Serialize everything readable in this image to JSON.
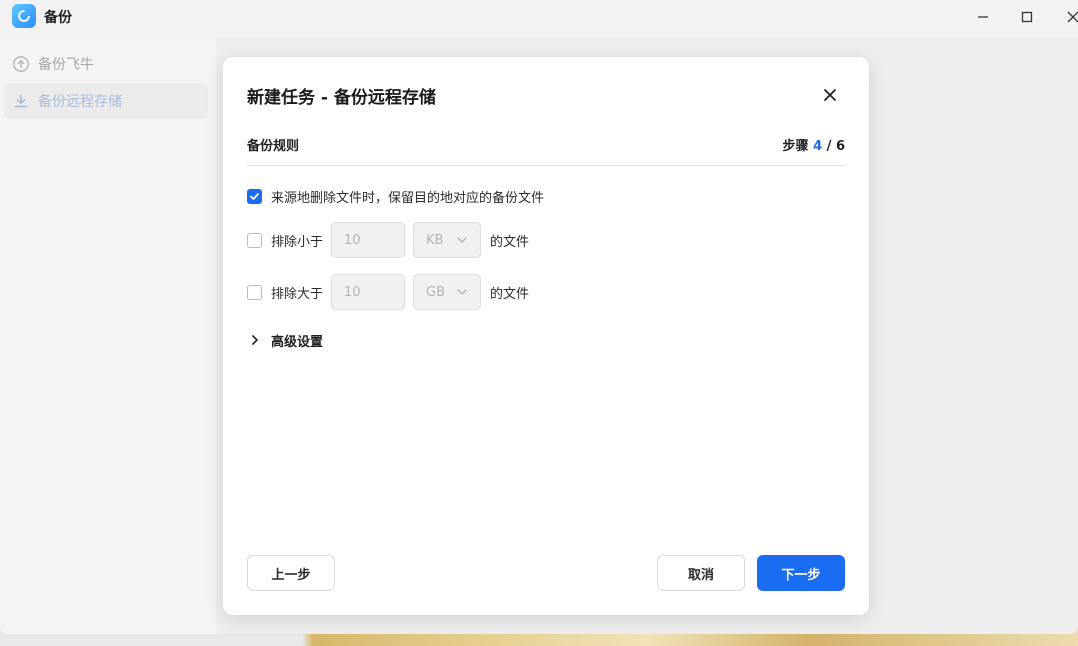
{
  "window": {
    "title": "备份"
  },
  "sidebar": {
    "items": [
      {
        "label": "备份飞牛",
        "icon": "cloud-upload-icon"
      },
      {
        "label": "备份远程存储",
        "icon": "download-icon"
      }
    ]
  },
  "modal": {
    "title": "新建任务 - 备份远程存储",
    "section_title": "备份规则",
    "step": {
      "label": "步骤",
      "current": "4",
      "separator": "/",
      "total": "6"
    },
    "keep_deleted": {
      "checked": true,
      "label": "来源地删除文件时，保留目的地对应的备份文件"
    },
    "exclude_smaller": {
      "checked": false,
      "label": "排除小于",
      "value": "10",
      "unit": "KB",
      "suffix": "的文件"
    },
    "exclude_larger": {
      "checked": false,
      "label": "排除大于",
      "value": "10",
      "unit": "GB",
      "suffix": "的文件"
    },
    "advanced_label": "高级设置",
    "buttons": {
      "prev": "上一步",
      "cancel": "取消",
      "next": "下一步"
    }
  },
  "colors": {
    "accent": "#1a6cf0"
  }
}
